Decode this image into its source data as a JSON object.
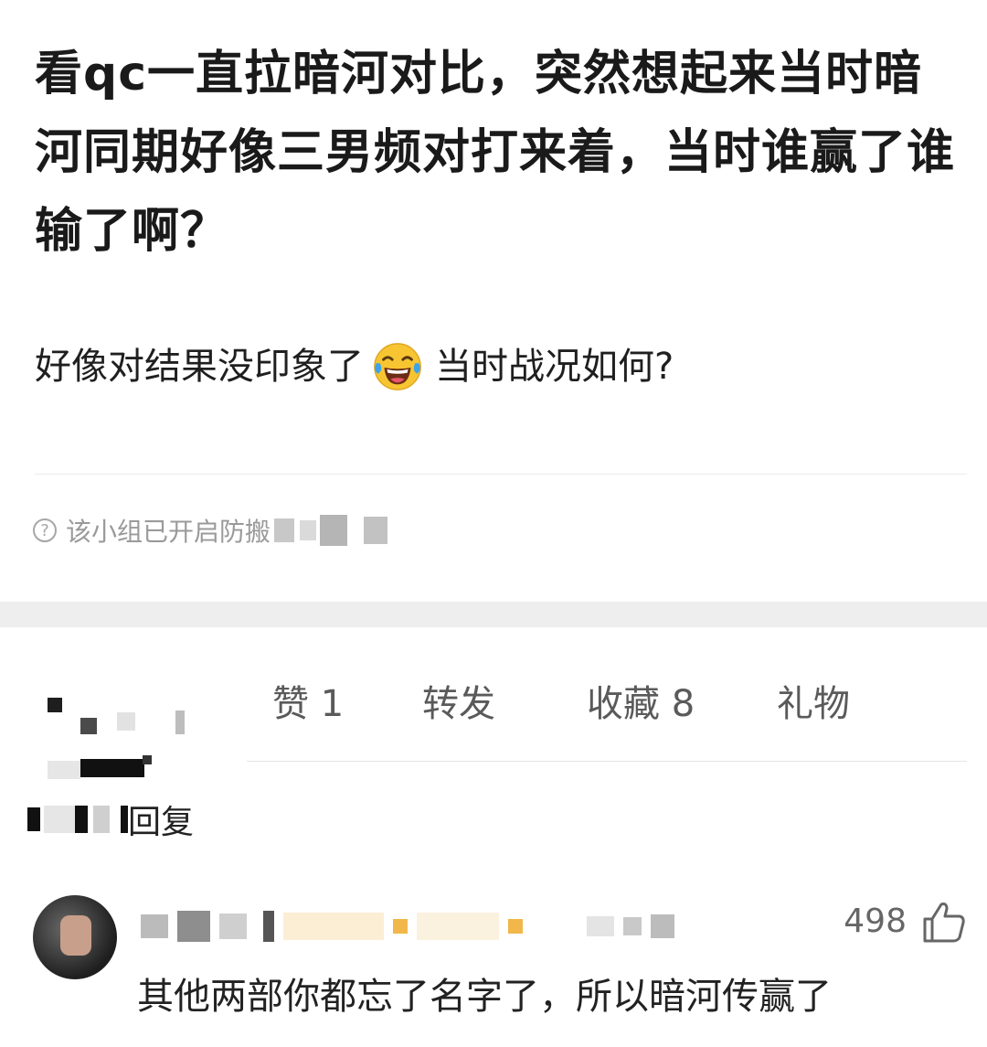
{
  "post": {
    "title": "看qc一直拉暗河对比，突然想起来当时暗河同期好像三男频对打来着，当时谁赢了谁输了啊？",
    "body_before_emoji": "好像对结果没印象了",
    "emoji": "face-with-tears-of-joy-icon",
    "body_after_emoji": "当时战况如何?"
  },
  "notice": {
    "text": "该小组已开启防搬"
  },
  "actions": {
    "like": "赞 1",
    "repost": "转发",
    "favorite": "收藏 8",
    "gift": "礼物"
  },
  "tabs": {
    "reply_label": "回复"
  },
  "comment": {
    "text": "其他两部你都忘了名字了，所以暗河传赢了",
    "likes": "498"
  },
  "colors": {
    "background": "#ffffff",
    "title": "#1a1a1a",
    "muted": "#9a9a9a",
    "band": "#eeeeee"
  }
}
